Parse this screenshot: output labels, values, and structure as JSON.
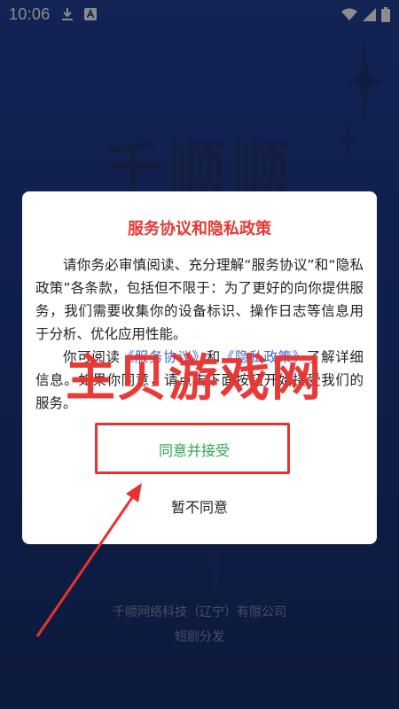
{
  "status_bar": {
    "time": "10:06"
  },
  "background": {
    "logo_text": "千顺顺",
    "company": "千顺网络科技（辽宁）有限公司",
    "subtitle": "短剧分发"
  },
  "dialog": {
    "title": "服务协议和隐私政策",
    "paragraph1": "请你务必审慎阅读、充分理解“服务协议”和“隐私政策”各条款，包括但不限于：为了更好的向你提供服务，我们需要收集你的设备标识、操作日志等信息用于分析、优化应用性能。",
    "paragraph2_prefix": "你可阅读",
    "service_link": "《服务协议》",
    "paragraph2_mid": "和",
    "privacy_link": "《隐私政策》",
    "paragraph2_suffix": "了解详细信息。如果你同意，请点击下面按钮开始接受我们的服务。",
    "accept_label": "同意并接受",
    "decline_label": "暂不同意"
  },
  "watermark": {
    "text": "主贝游戏网"
  },
  "colors": {
    "title": "#e53935",
    "accept": "#2ea44f",
    "link": "#3b6bd6",
    "annotation": "#e8322f"
  }
}
